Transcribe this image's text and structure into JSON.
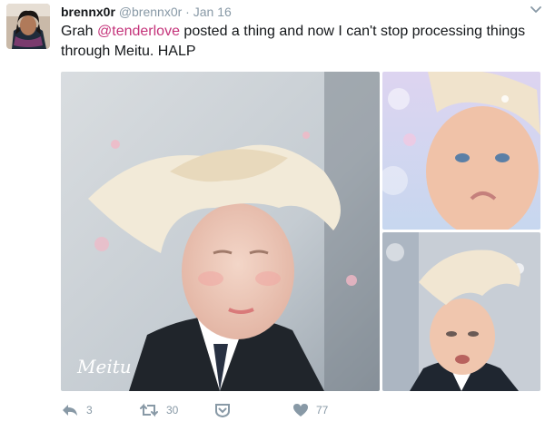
{
  "tweet": {
    "display_name": "brennx0r",
    "handle": "@brennx0r",
    "separator": "·",
    "timestamp": "Jan 16",
    "text_before": "Grah ",
    "mention": "@tenderlove",
    "text_after": " posted a thing and now I can't stop processing things through Meitu. HALP"
  },
  "photos": {
    "watermark": "Meitu"
  },
  "actions": {
    "reply_count": "3",
    "retweet_count": "30",
    "like_count": "77"
  },
  "icons": {
    "reply": "reply-icon",
    "retweet": "retweet-icon",
    "moderate": "shield-down-icon",
    "like": "heart-icon",
    "more": "chevron-down-icon"
  },
  "colors": {
    "mention": "#c4337a",
    "muted": "#8899a6",
    "text": "#14171a"
  }
}
